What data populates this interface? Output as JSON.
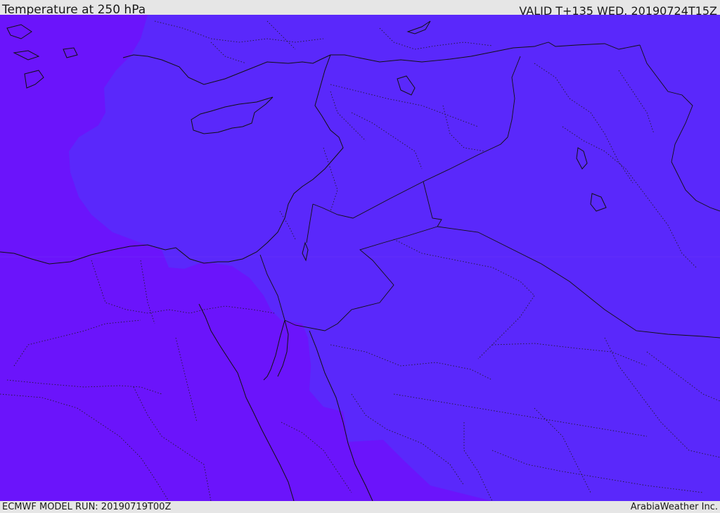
{
  "header": {
    "title": "Temperature at 250 hPa",
    "valid": "VALID T+135 WED. 20190724T15Z"
  },
  "footer": {
    "model_run": "ECMWF MODEL RUN: 20190719T00Z",
    "credit": "ArabiaWeather Inc."
  },
  "colors": {
    "cold_band": "#6b14fb",
    "warm_band": "#5a28fb",
    "border": "#111111",
    "background": "#e6e6e6"
  },
  "icons": [
    "map-panel"
  ]
}
